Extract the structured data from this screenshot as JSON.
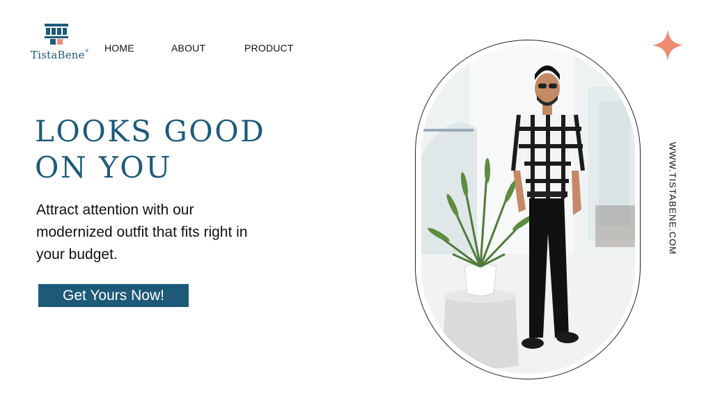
{
  "brand": {
    "name": "TistaBene",
    "trademark": "®"
  },
  "nav": {
    "items": [
      {
        "label": "HOME"
      },
      {
        "label": "ABOUT"
      },
      {
        "label": "PRODUCT"
      }
    ]
  },
  "hero": {
    "headline_line1": "LOOKS GOOD",
    "headline_line2": "ON YOU",
    "body": "Attract attention with our modernized outfit that fits right in your budget.",
    "cta_label": "Get Yours Now!"
  },
  "side": {
    "url": "WWW.TISTABENE.COM"
  },
  "colors": {
    "accent": "#1d5a7a",
    "sparkle": "#f08a70",
    "text": "#111111",
    "background": "#ffffff"
  },
  "icons": {
    "sparkle": "sparkle-icon",
    "logo": "tistabene-logo-icon"
  }
}
